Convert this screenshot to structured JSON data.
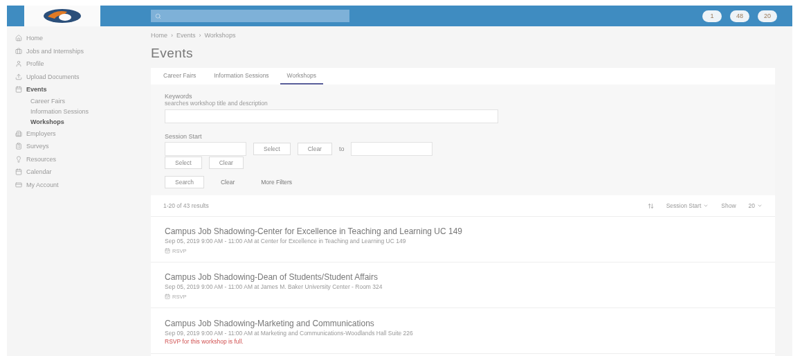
{
  "header": {
    "badges": [
      "1",
      "48",
      "20"
    ]
  },
  "sidebar": {
    "items": [
      {
        "label": "Home",
        "selected": false
      },
      {
        "label": "Jobs and Internships",
        "selected": false
      },
      {
        "label": "Profile",
        "selected": false
      },
      {
        "label": "Upload Documents",
        "selected": false
      },
      {
        "label": "Events",
        "selected": false,
        "expanded": true,
        "children": [
          {
            "label": "Career Fairs",
            "selected": false
          },
          {
            "label": "Information Sessions",
            "selected": false
          },
          {
            "label": "Workshops",
            "selected": true
          }
        ]
      },
      {
        "label": "Employers",
        "selected": false
      },
      {
        "label": "Surveys",
        "selected": false
      },
      {
        "label": "Resources",
        "selected": false
      },
      {
        "label": "Calendar",
        "selected": false
      },
      {
        "label": "My Account",
        "selected": false
      }
    ]
  },
  "breadcrumb": {
    "separator": "›",
    "items": [
      "Home",
      "Events",
      "Workshops"
    ]
  },
  "title": "Events",
  "tabs": [
    {
      "label": "Career Fairs",
      "selected": false
    },
    {
      "label": "Information Sessions",
      "selected": false
    },
    {
      "label": "Workshops",
      "selected": true
    }
  ],
  "filters": {
    "keywords_label": "Keywords",
    "keywords_hint": "searches workshop title and description",
    "session_label": "Session Start",
    "select": "Select",
    "clear": "Clear",
    "to": "to",
    "select2": "Select",
    "clear2": "Clear",
    "search": "Search",
    "clear_all": "Clear",
    "more": "More Filters"
  },
  "results": {
    "count": "1-20 of 43 results",
    "sort": "Session Start",
    "show_label": "Show",
    "show": "20",
    "items": [
      {
        "title": "Campus Job Shadowing-Center for Excellence in Teaching and Learning UC 149",
        "meta": "Sep 05, 2019 9:00 AM - 11:00 AM at Center for Excellence in Teaching and Learning UC 149",
        "action": {
          "kind": "rsvp",
          "text": "RSVP"
        }
      },
      {
        "title": "Campus Job Shadowing-Dean of Students/Student Affairs",
        "meta": "Sep 05, 2019 9:00 AM - 11:00 AM at James M. Baker University Center - Room 324",
        "action": {
          "kind": "rsvp",
          "text": "RSVP"
        }
      },
      {
        "title": "Campus Job Shadowing-Marketing and Communications",
        "meta": "Sep 09, 2019 9:00 AM - 11:00 AM at Marketing and Communications-Woodlands Hall Suite 226",
        "action": {
          "kind": "full",
          "text": "RSVP for this workshop is full."
        }
      }
    ]
  }
}
